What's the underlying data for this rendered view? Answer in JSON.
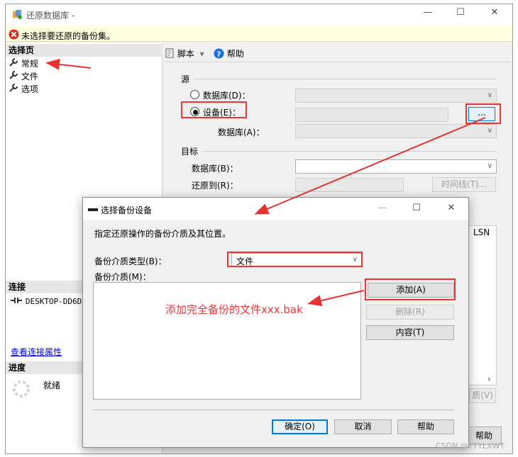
{
  "window": {
    "title": "还原数据库 -",
    "min": "—",
    "max": "☐",
    "close": "✕"
  },
  "warning": {
    "text": "未选择要还原的备份集。",
    "icon": "error-icon"
  },
  "sidebar": {
    "select_page_header": "选择页",
    "items": [
      {
        "label": "常规"
      },
      {
        "label": "文件"
      },
      {
        "label": "选项"
      }
    ],
    "connection_header": "连接",
    "server": "DESKTOP-DD6D",
    "view_conn_props": "查看连接属性",
    "progress_header": "进度",
    "progress_status": "就绪"
  },
  "toolbar": {
    "script_label": "脚本",
    "help_label": "帮助",
    "dropdown": "▾"
  },
  "source": {
    "header": "源",
    "database_radio": "数据库(D)：",
    "device_radio": "设备(E)：",
    "browse_button": "...",
    "database_label": "数据库(A)："
  },
  "target": {
    "header": "目标",
    "database_label": "数据库(B)：",
    "restore_to_label": "还原到(R)：",
    "timeline_button": "时间线(T)..."
  },
  "behind": {
    "lsn_text": "LSN",
    "verify_button": "质(V)",
    "help_button": "帮助",
    "scroll_right": "›"
  },
  "dialog": {
    "title": "选择备份设备",
    "min": "—",
    "max": "☐",
    "close": "✕",
    "description": "指定还原操作的备份介质及其位置。",
    "media_type_label": "备份介质类型(B)：",
    "media_type_value": "文件",
    "media_label": "备份介质(M)：",
    "add_button": "添加(A)",
    "delete_button": "删除(R)",
    "content_button": "内容(T)",
    "ok_button": "确定(O)",
    "cancel_button": "取消",
    "help_button": "帮助"
  },
  "annotation": {
    "text": "添加完全备份的文件xxx.bak"
  },
  "watermark": "CSDN @TTYLXWT",
  "colors": {
    "annotation_red": "#e33333",
    "link_blue": "#0000ee",
    "warning_bg": "#ffffe1"
  }
}
